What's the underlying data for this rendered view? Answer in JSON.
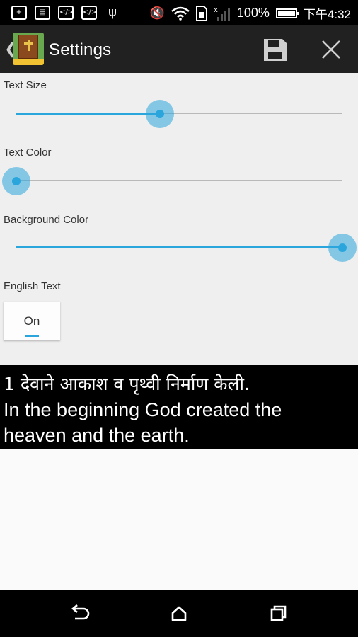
{
  "status_bar": {
    "left_icons": [
      "add-notification-icon",
      "gallery-icon",
      "code-icon",
      "code-icon",
      "usb-icon"
    ],
    "battery": "100%",
    "battery_level": 1.0,
    "time": "下午4:32"
  },
  "action_bar": {
    "title": "Settings",
    "icons": [
      "back-icon",
      "bible-app-icon",
      "save-icon",
      "close-icon"
    ]
  },
  "settings": {
    "text_size": {
      "label": "Text Size",
      "value": 0.44
    },
    "text_color": {
      "label": "Text Color",
      "value": 0.0
    },
    "background_color": {
      "label": "Background Color",
      "value": 1.0
    },
    "english_text": {
      "label": "English Text",
      "toggle": "On"
    }
  },
  "preview": {
    "line1": "1 देवाने आकाश व पृथ्वी निर्माण केली.",
    "line2": "In the beginning God created the",
    "line3": "heaven and the earth."
  },
  "colors": {
    "accent": "#2aa6dd",
    "action_bar": "#212121",
    "panel": "#efefef",
    "preview_bg": "#000000"
  },
  "nav_bar": {
    "icons": [
      "back-nav-icon",
      "home-icon",
      "recents-icon"
    ]
  }
}
